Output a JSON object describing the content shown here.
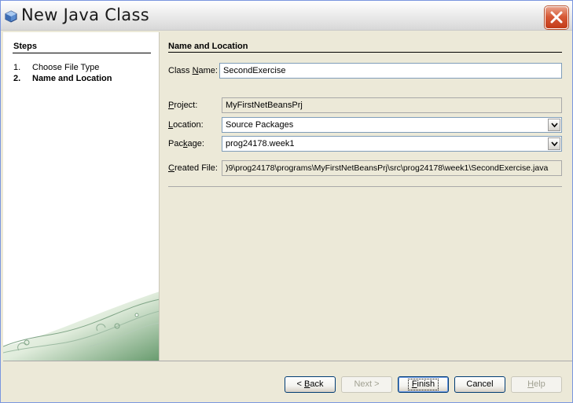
{
  "window": {
    "title": "New Java Class"
  },
  "steps": {
    "title": "Steps",
    "items": [
      {
        "num": "1.",
        "label": "Choose File Type",
        "current": false
      },
      {
        "num": "2.",
        "label": "Name and Location",
        "current": true
      }
    ]
  },
  "panel": {
    "title": "Name and Location",
    "class_name": {
      "label_pre": "Class ",
      "label_u": "N",
      "label_post": "ame:",
      "value": "SecondExercise"
    },
    "project": {
      "label_pre": "",
      "label_u": "P",
      "label_post": "roject:",
      "value": "MyFirstNetBeansPrj"
    },
    "location": {
      "label_pre": "",
      "label_u": "L",
      "label_post": "ocation:",
      "value": "Source Packages"
    },
    "package": {
      "label_pre": "Pac",
      "label_u": "k",
      "label_post": "age:",
      "value": "prog24178.week1"
    },
    "created_file": {
      "label_pre": "",
      "label_u": "C",
      "label_post": "reated File:",
      "value": ")9\\prog24178\\programs\\MyFirstNetBeansPrj\\src\\prog24178\\week1\\SecondExercise.java"
    }
  },
  "buttons": {
    "back": {
      "pre": "< ",
      "u": "B",
      "post": "ack"
    },
    "next": {
      "label": "Next >"
    },
    "finish": {
      "pre": "",
      "u": "F",
      "post": "inish"
    },
    "cancel": {
      "label": "Cancel"
    },
    "help": {
      "pre": "",
      "u": "H",
      "post": "elp"
    }
  }
}
